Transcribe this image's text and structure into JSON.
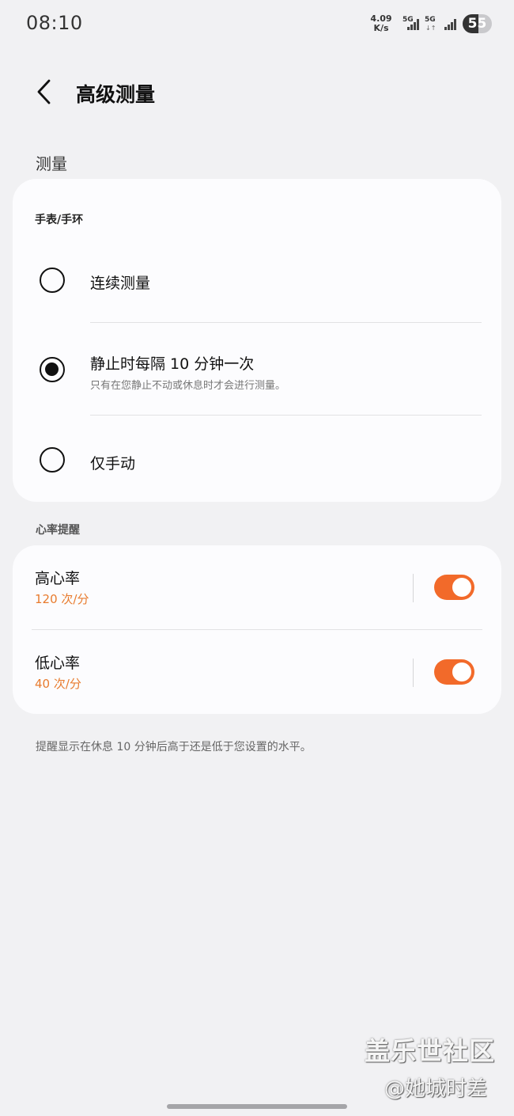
{
  "status_bar": {
    "time": "08:10",
    "net_speed_value": "4.09",
    "net_speed_unit": "K/s",
    "sim1_label": "5G",
    "sim2_label": "5G",
    "battery": "55",
    "battery_level_percent": 55
  },
  "header": {
    "back_icon": "chevron-left-icon",
    "title": "高级测量"
  },
  "measurement": {
    "section_label": "测量",
    "device_label": "手表/手环",
    "options": [
      {
        "label": "连续测量",
        "description": "",
        "selected": false
      },
      {
        "label": "静止时每隔 10 分钟一次",
        "description": "只有在您静止不动或休息时才会进行测量。",
        "selected": true
      },
      {
        "label": "仅手动",
        "description": "",
        "selected": false
      }
    ]
  },
  "heart_rate_alerts": {
    "section_label": "心率提醒",
    "items": [
      {
        "label": "高心率",
        "value": "120 次/分",
        "enabled": true
      },
      {
        "label": "低心率",
        "value": "40 次/分",
        "enabled": true
      }
    ],
    "note": "提醒显示在休息 10 分钟后高于还是低于您设置的水平。"
  },
  "colors": {
    "accent": "#f26a2a",
    "value_text": "#e87b2e",
    "background": "#f1f1f3",
    "card": "#fcfcfe"
  },
  "watermark": {
    "title": "盖乐世社区",
    "handle": "@她城时差"
  }
}
